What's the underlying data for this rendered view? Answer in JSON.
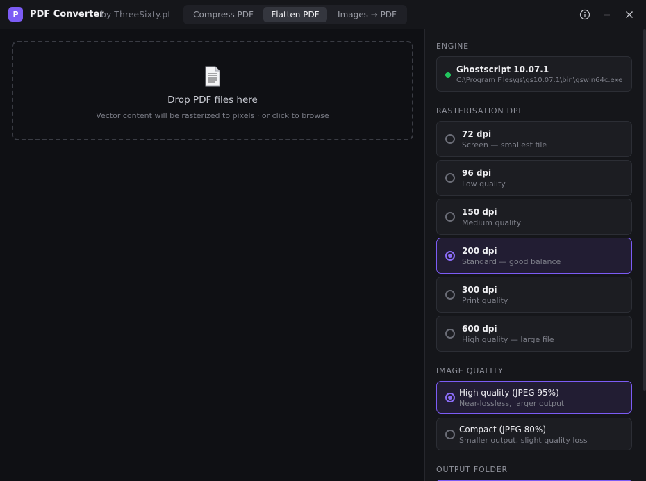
{
  "app": {
    "logo_letter": "P",
    "title": "PDF Converter",
    "subtitle": "by ThreeSixty.pt"
  },
  "tabs": [
    {
      "label": "Compress PDF",
      "active": false
    },
    {
      "label": "Flatten PDF",
      "active": true
    },
    {
      "label": "Images → PDF",
      "active": false
    }
  ],
  "window_controls": [
    "info-icon",
    "minimize-icon",
    "close-icon"
  ],
  "dropzone": {
    "icon": "document-icon",
    "title": "Drop PDF files here",
    "subtitle": "Vector content will be rasterized to pixels · or click to browse"
  },
  "engine": {
    "section_label": "ENGINE",
    "name": "Ghostscript 10.07.1",
    "path": "C:\\Program Files\\gs\\gs10.07.1\\bin\\gswin64c.exe",
    "status_color": "#22c55e"
  },
  "dpi": {
    "section_label": "RASTERISATION DPI",
    "options": [
      {
        "title": "72 dpi",
        "desc": "Screen — smallest file",
        "selected": false
      },
      {
        "title": "96 dpi",
        "desc": "Low quality",
        "selected": false
      },
      {
        "title": "150 dpi",
        "desc": "Medium quality",
        "selected": false
      },
      {
        "title": "200 dpi",
        "desc": "Standard — good balance",
        "selected": true
      },
      {
        "title": "300 dpi",
        "desc": "Print quality",
        "selected": false
      },
      {
        "title": "600 dpi",
        "desc": "High quality — large file",
        "selected": false
      }
    ]
  },
  "quality": {
    "section_label": "IMAGE QUALITY",
    "options": [
      {
        "title": "High quality (JPEG 95%)",
        "desc": "Near-lossless, larger output",
        "selected": true
      },
      {
        "title": "Compact (JPEG 80%)",
        "desc": "Smaller output, slight quality loss",
        "selected": false
      }
    ]
  },
  "output": {
    "section_label": "OUTPUT FOLDER"
  },
  "colors": {
    "accent": "#7c5cf5",
    "background": "#0f1014",
    "panel": "#15161a"
  }
}
